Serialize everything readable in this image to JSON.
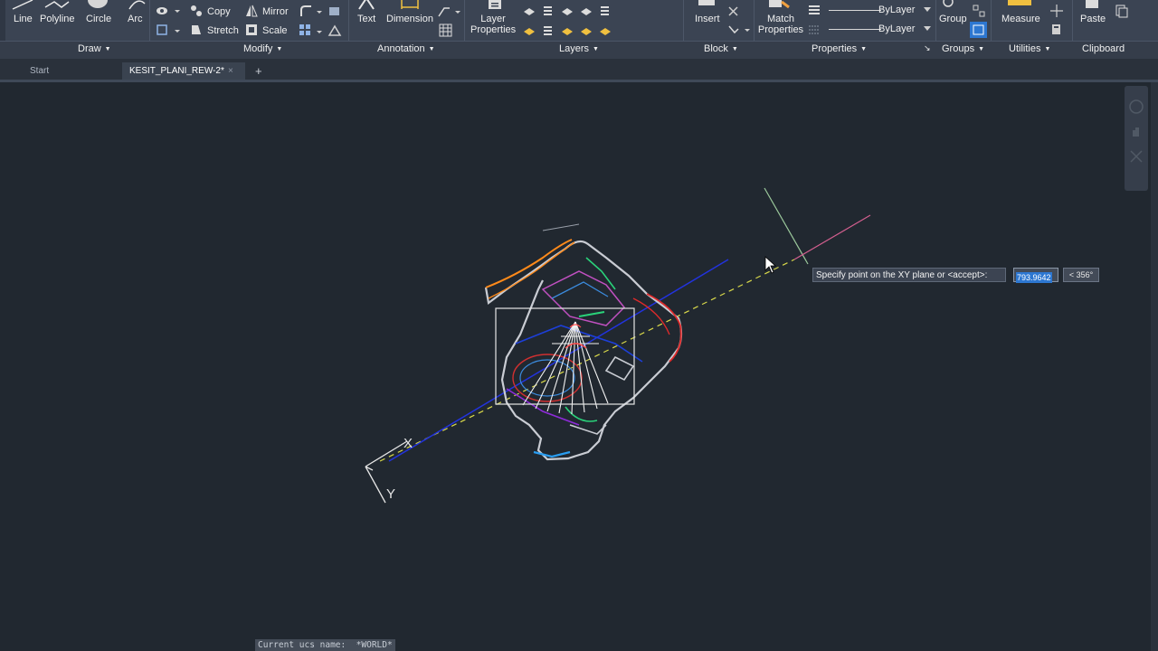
{
  "ribbon": {
    "draw": {
      "line": "Line",
      "polyline": "Polyline",
      "circle": "Circle",
      "arc": "Arc"
    },
    "modify": {
      "copy": "Copy",
      "mirror": "Mirror",
      "stretch": "Stretch",
      "scale": "Scale"
    },
    "annotation": {
      "text": "Text",
      "dimension": "Dimension"
    },
    "layers": {
      "layer_properties": "Layer\nProperties"
    },
    "block": {
      "insert": "Insert"
    },
    "properties": {
      "match_properties": "Match\nProperties",
      "bylayer_1": "ByLayer",
      "bylayer_2": "ByLayer"
    },
    "groups": {
      "group": "Group"
    },
    "utilities": {
      "measure": "Measure"
    },
    "clipboard": {
      "paste": "Paste"
    }
  },
  "panels": [
    "Draw",
    "Modify",
    "Annotation",
    "Layers",
    "Block",
    "Properties",
    "Groups",
    "Utilities",
    "Clipboard"
  ],
  "tabs": {
    "start": "Start",
    "active": "KESIT_PLANI_REW-2*"
  },
  "ucs": {
    "x_label": "X",
    "y_label": "Y"
  },
  "prompt": {
    "text": "Specify point on the XY plane or <accept>:",
    "value": "793.9642",
    "angle": "< 356°"
  },
  "command_history": "Current ucs name:  *WORLD*",
  "colors": {
    "canvas": "#212830",
    "ribbon": "#3b4453",
    "accent": "#2d77d1"
  }
}
